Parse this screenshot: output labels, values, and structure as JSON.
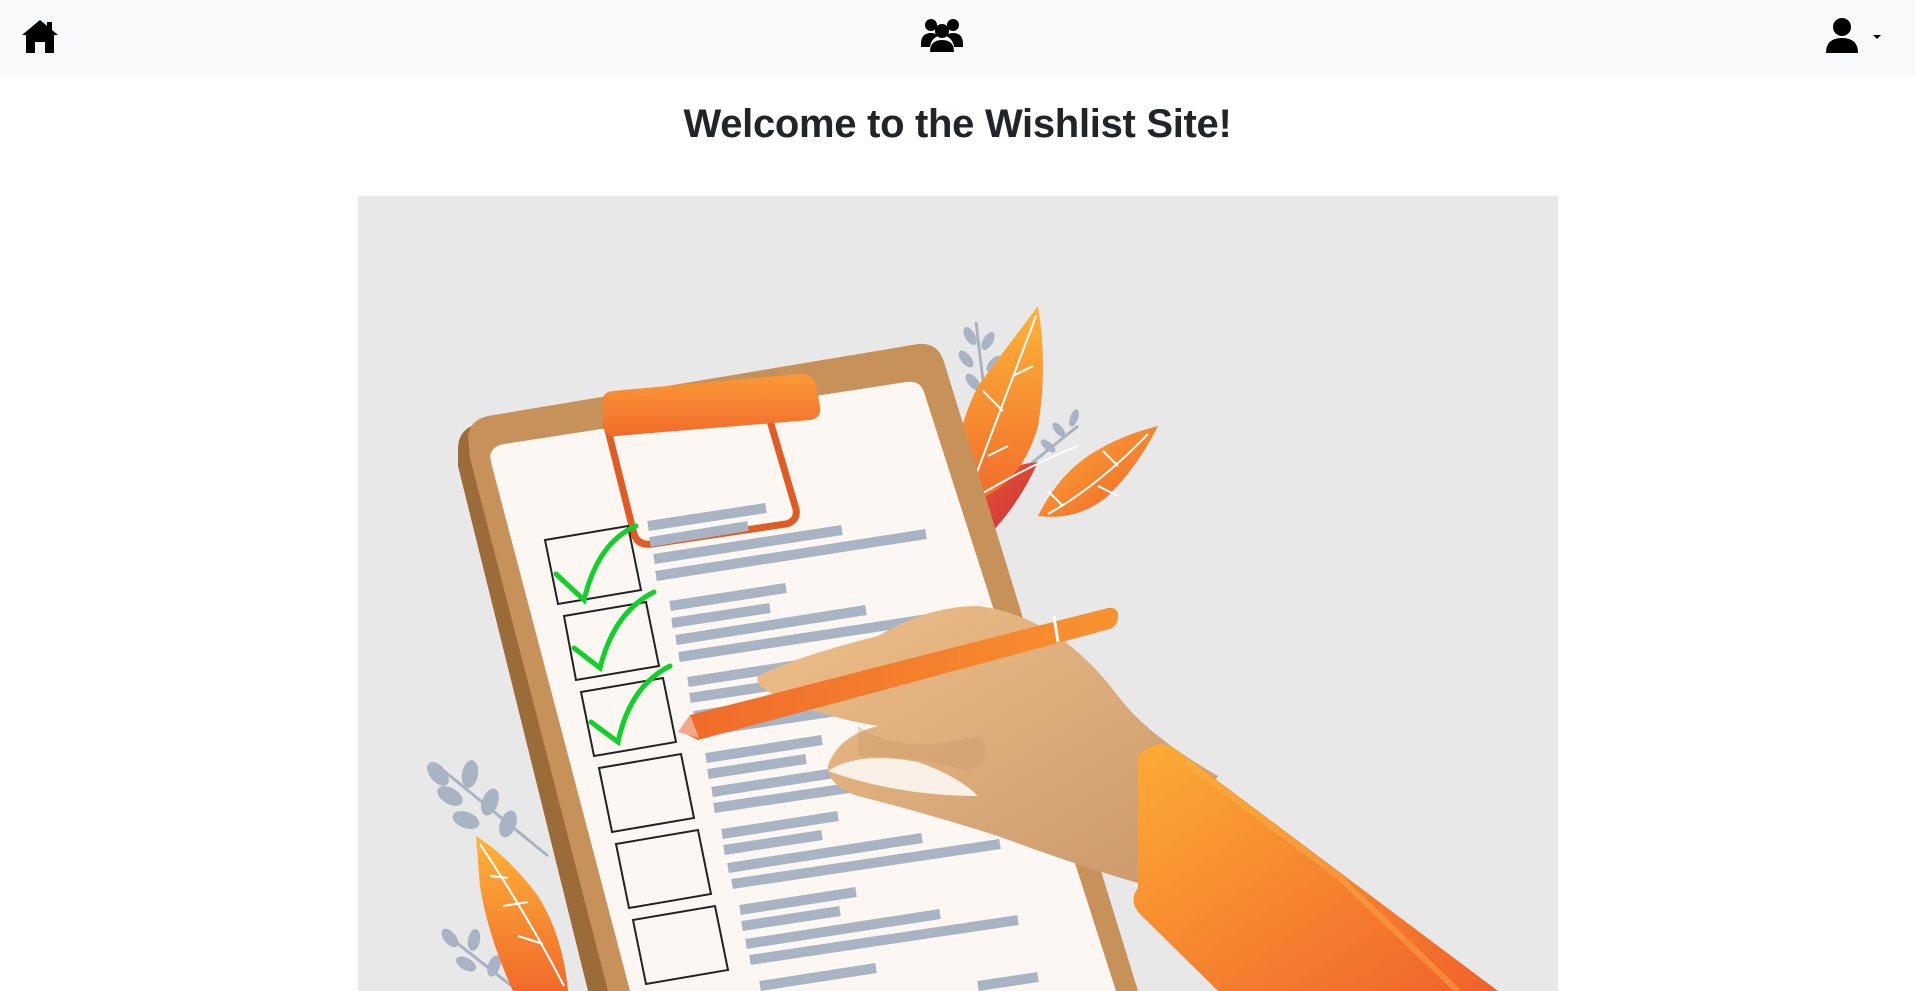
{
  "navbar": {
    "home_icon": "home-icon",
    "groups_icon": "users-group-icon",
    "user_icon": "user-icon",
    "dropdown_icon": "caret-down-icon"
  },
  "main": {
    "title": "Welcome to the Wishlist Site!"
  },
  "hero": {
    "illustration": "clipboard-checklist-illustration",
    "checkboxes": [
      {
        "checked": true
      },
      {
        "checked": true
      },
      {
        "checked": true
      },
      {
        "checked": false
      },
      {
        "checked": false
      },
      {
        "checked": false
      }
    ],
    "colors": {
      "background": "#e8e8e8",
      "orange": "#f7862c",
      "check_green": "#10d12a",
      "line_gray": "#a8b4c4",
      "skin": "#e2b17f"
    }
  }
}
